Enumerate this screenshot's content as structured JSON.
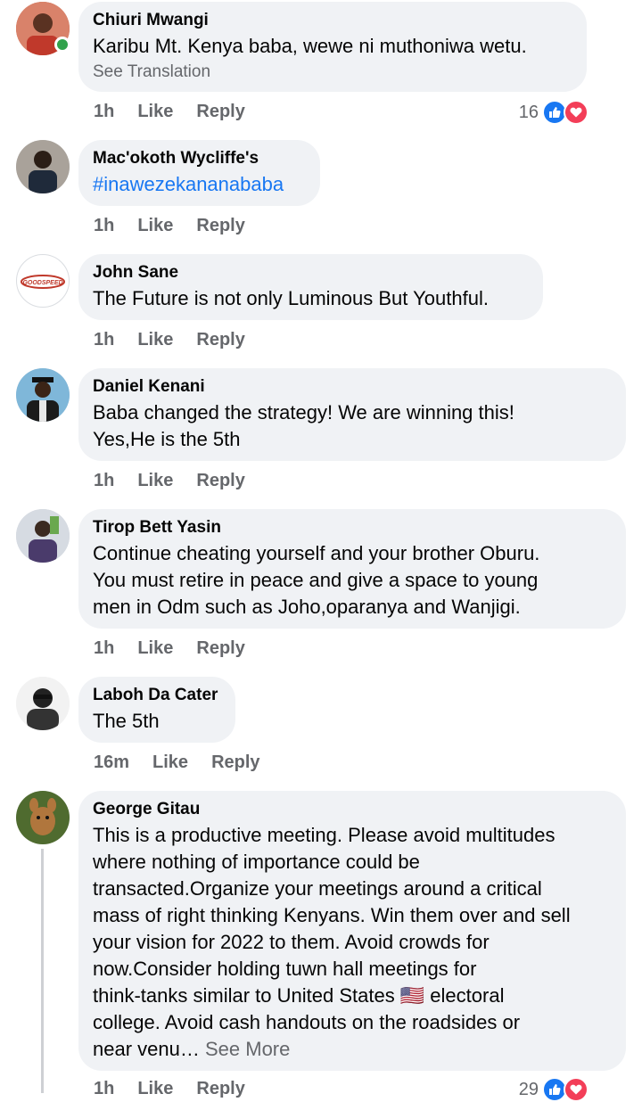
{
  "comments": [
    {
      "author": "Chiuri Mwangi",
      "text": "Karibu Mt. Kenya baba, wewe ni muthoniwa wetu.",
      "translation_link": "See Translation",
      "time": "1h",
      "like": "Like",
      "reply": "Reply",
      "reaction_count": "16"
    },
    {
      "author": "Mac'okoth Wycliffe's",
      "text": "#inawezekananababa",
      "time": "1h",
      "like": "Like",
      "reply": "Reply"
    },
    {
      "author": "John Sane",
      "text": "The Future is not only Luminous But Youthful.",
      "time": "1h",
      "like": "Like",
      "reply": "Reply",
      "avatar_logo_text": "GOODSPEED"
    },
    {
      "author": "Daniel Kenani",
      "text_lines": [
        "Baba changed the strategy! We are winning this!",
        "Yes,He is the 5th"
      ],
      "time": "1h",
      "like": "Like",
      "reply": "Reply"
    },
    {
      "author": "Tirop Bett Yasin",
      "text_lines": [
        "Continue cheating yourself and your brother Oburu.",
        "You must retire in peace and give a space to young",
        "men in Odm such as Joho,oparanya and Wanjigi."
      ],
      "time": "1h",
      "like": "Like",
      "reply": "Reply"
    },
    {
      "author": "Laboh Da Cater",
      "text": "The 5th",
      "time": "16m",
      "like": "Like",
      "reply": "Reply"
    },
    {
      "author": "George Gitau",
      "text_lines": [
        "This is a productive meeting. Please avoid multitudes",
        "where nothing of importance could be",
        "transacted.Organize your meetings around a critical",
        "mass of right thinking Kenyans. Win them over and sell",
        "your vision for 2022 to them. Avoid crowds for",
        "now.Consider holding tuwn hall meetings for",
        "think-tanks similar to United States 🇺🇸 electoral",
        "college. Avoid cash  handouts on the roadsides or",
        "near venu…"
      ],
      "see_more": "See More",
      "time": "1h",
      "like": "Like",
      "reply": "Reply",
      "reaction_count": "29"
    }
  ],
  "colors": {
    "bubble": "#f0f2f5",
    "meta": "#65676b",
    "link": "#1877f2",
    "like_reaction": "#1877f2",
    "love_reaction": "#f33e58",
    "online": "#31a24c"
  },
  "icons": [
    "thumbs-up-icon",
    "heart-icon"
  ]
}
